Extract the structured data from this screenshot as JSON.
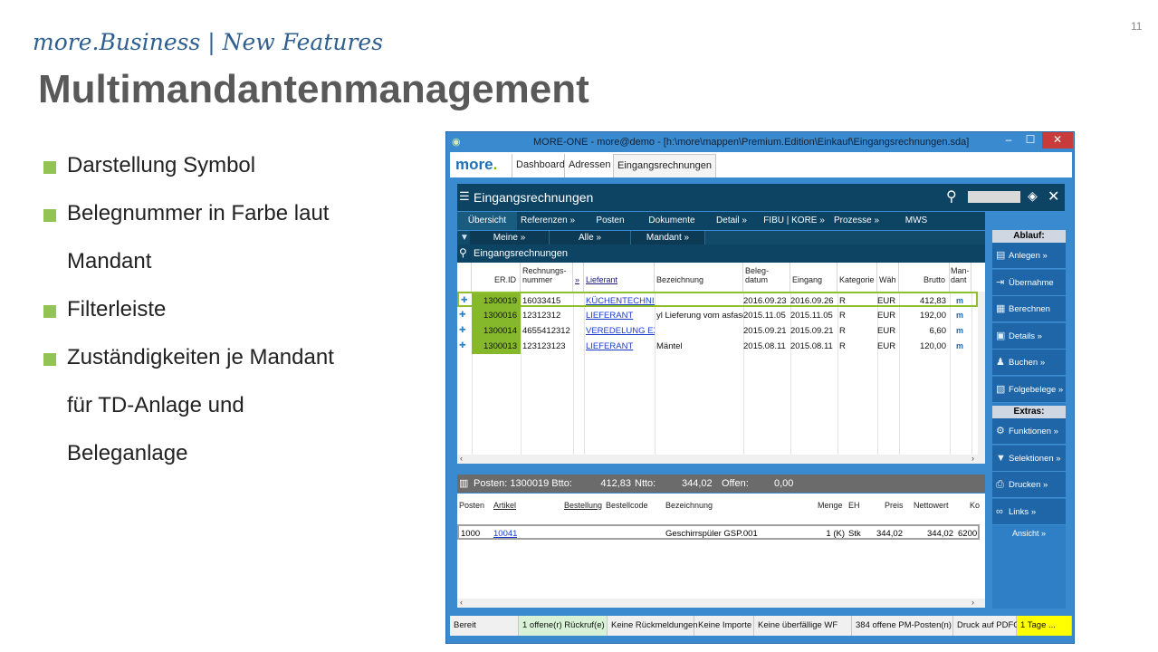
{
  "slide": {
    "number": "11",
    "subtitle": "more.Business | New Features",
    "title": "Multimandantenmanagement",
    "bullets": [
      [
        "Darstellung Symbol"
      ],
      [
        "Belegnummer in Farbe laut",
        "Mandant"
      ],
      [
        "Filterleiste"
      ],
      [
        "Zuständigkeiten je Mandant",
        "für TD-Anlage und",
        "Beleganlage"
      ]
    ]
  },
  "window": {
    "title": "MORE-ONE - more@demo - [h:\\more\\mappen\\Premium.Edition\\Einkauf\\Eingangsrechnungen.sda]",
    "logo_text": "more",
    "tabs": [
      "Dashboard",
      "Adressen",
      "Eingangsrechnungen"
    ]
  },
  "module": {
    "title": "Eingangsrechnungen",
    "nav_tabs": [
      "Übersicht",
      "Referenzen »",
      "Posten",
      "Dokumente",
      "Detail »",
      "FIBU | KORE »",
      "Prozesse »",
      "MWS"
    ],
    "filters": [
      "Meine »",
      "Alle »",
      "Mandant »"
    ],
    "section_title": "Eingangsrechnungen"
  },
  "grid": {
    "columns": [
      "ER.ID",
      "Rechnungs-\nnummer",
      "»",
      "Lieferant",
      "Bezeichnung",
      "Beleg-\ndatum",
      "Eingang",
      "Kategorie",
      "Wäh",
      "Brutto",
      "Man-\ndant"
    ],
    "rows": [
      {
        "erid": "1300019",
        "nr": "16033415",
        "lieferant": "KÜCHENTECHNIK",
        "bez": "",
        "beleg": "2016.09.23",
        "eingang": "2016.09.26",
        "kat": "R",
        "wae": "EUR",
        "brutto": "412,83",
        "mandant": "m"
      },
      {
        "erid": "1300016",
        "nr": "12312312",
        "lieferant": "LIEFERANT",
        "bez": "yl Lieferung vom asfasdf",
        "beleg": "2015.11.05",
        "eingang": "2015.11.05",
        "kat": "R",
        "wae": "EUR",
        "brutto": "192,00",
        "mandant": "m"
      },
      {
        "erid": "1300014",
        "nr": "4655412312",
        "lieferant": "VEREDELUNG EXT",
        "bez": "",
        "beleg": "2015.09.21",
        "eingang": "2015.09.21",
        "kat": "R",
        "wae": "EUR",
        "brutto": "6,60",
        "mandant": "m"
      },
      {
        "erid": "1300013",
        "nr": "123123123",
        "lieferant": "LIEFERANT",
        "bez": "Mäntel",
        "beleg": "2015.08.11",
        "eingang": "2015.08.11",
        "kat": "R",
        "wae": "EUR",
        "brutto": "120,00",
        "mandant": "m"
      }
    ]
  },
  "posten": {
    "summary": {
      "label": "Posten: 1300019 Btto:",
      "btto": "412,83",
      "ntto_label": "Ntto:",
      "ntto": "344,02",
      "offen_label": "Offen:",
      "offen": "0,00"
    },
    "columns": [
      "Posten",
      "Artikel",
      "Bestellung",
      "Bestellcode",
      "Bezeichnung",
      "Menge",
      "EH",
      "Preis",
      "Nettowert",
      "Ko"
    ],
    "row": {
      "posten": "1000",
      "artikel": "10041",
      "bestellung": "",
      "bestellcode": "",
      "bez": "Geschirrspüler GSP.001",
      "menge": "1 (K)",
      "eh": "Stk",
      "preis": "344,02",
      "netto": "344,02",
      "ko": "6200"
    }
  },
  "sidebar": {
    "ablauf_label": "Ablauf:",
    "ablauf": [
      "Anlegen »",
      "Übernahme",
      "Berechnen",
      "Details »",
      "Buchen »",
      "Folgebelege »"
    ],
    "extras_label": "Extras:",
    "extras": [
      "Funktionen »",
      "Selektionen »",
      "Drucken »",
      "Links »"
    ],
    "ansicht": "Ansicht »"
  },
  "status": [
    "Bereit",
    "1 offene(r) Rückruf(e)",
    "Keine Rückmeldungen",
    "Keine Importe",
    "Keine überfällige WF",
    "384 offene PM-Posten(n)",
    "Druck auf PDFC",
    "1 Tage ..."
  ]
}
